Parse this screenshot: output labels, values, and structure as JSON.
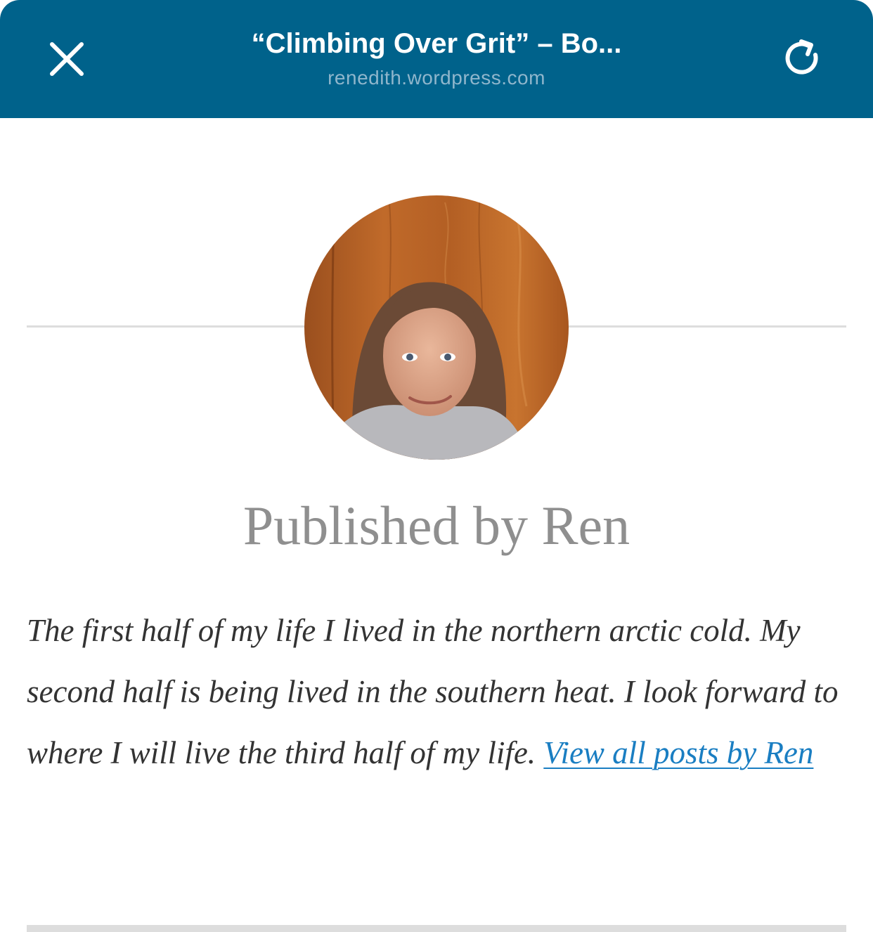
{
  "header": {
    "title": "“Climbing Over Grit” – Bo...",
    "domain": "renedith.wordpress.com",
    "close_icon": "close-icon",
    "refresh_icon": "refresh-icon",
    "background_color": "#00628b"
  },
  "author": {
    "avatar_icon": "author-avatar-photo",
    "heading": "Published by Ren",
    "bio": "The first half of my life I lived in the northern arctic cold. My second half is being lived in the southern heat. I look forward to where I will live the third half of my life.",
    "view_all_link": "View all posts by Ren",
    "link_color": "#1a7ec2"
  }
}
